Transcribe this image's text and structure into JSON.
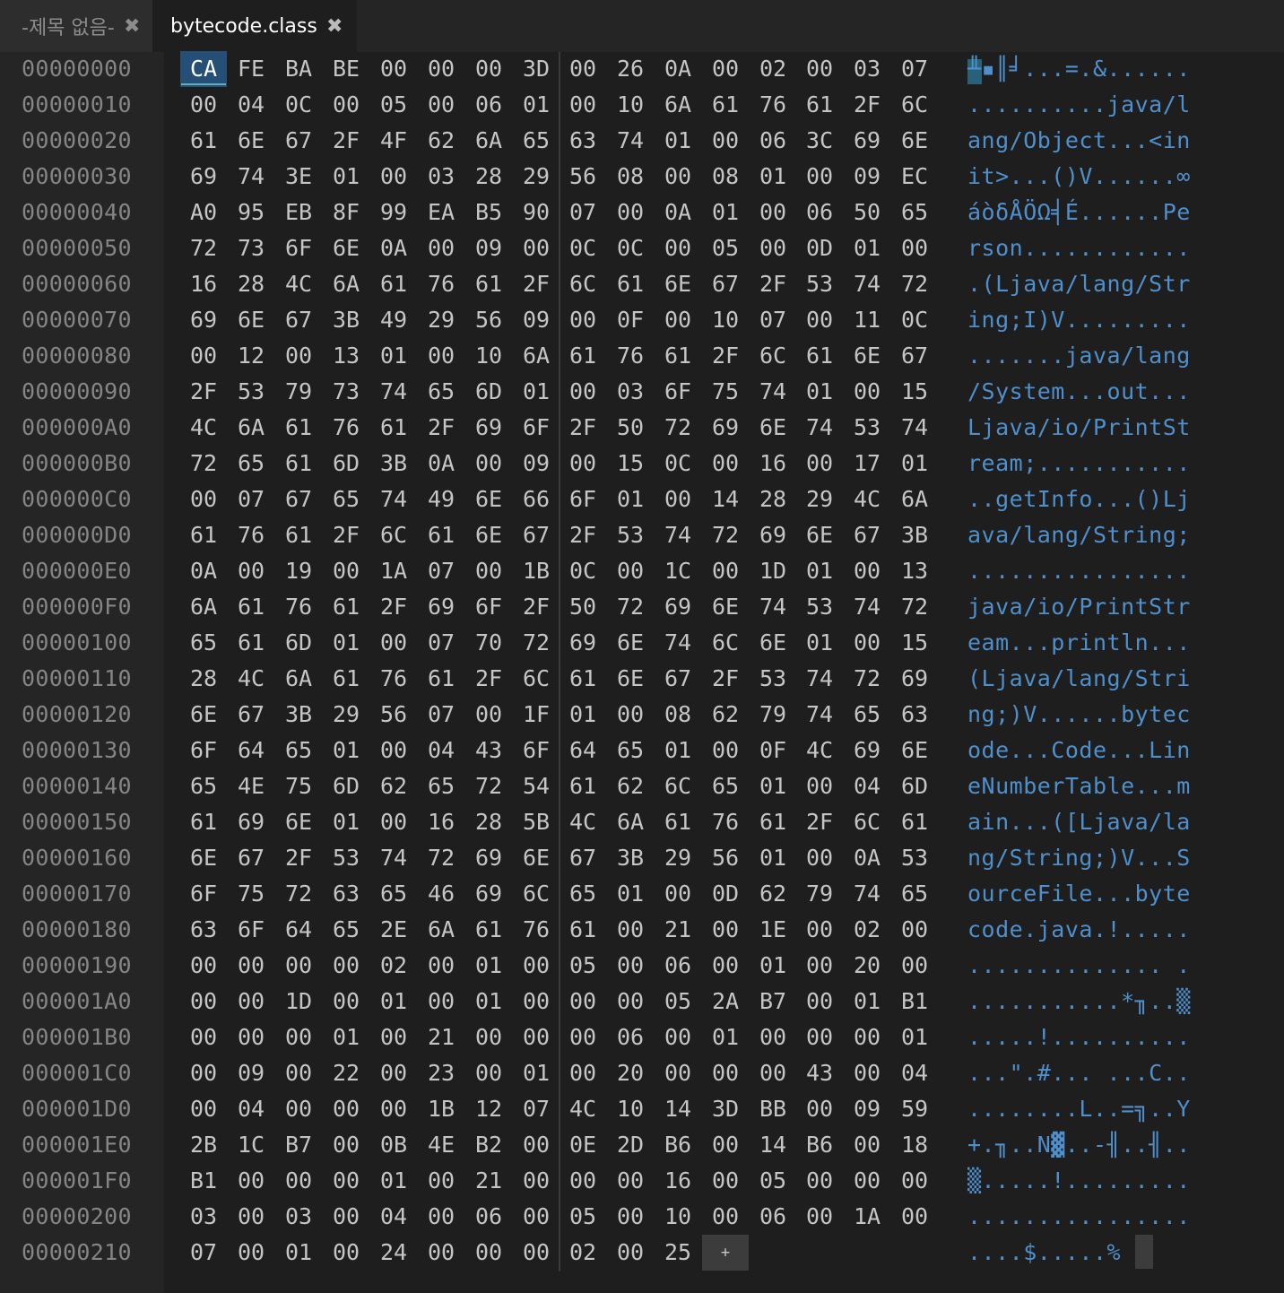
{
  "tabs": [
    {
      "label": "-제목 없음-",
      "active": false
    },
    {
      "label": "bytecode.class",
      "active": true
    }
  ],
  "close_glyph": "✖",
  "add_byte_label": "+",
  "selected": {
    "row": 0,
    "col": 0
  },
  "colors": {
    "accent": "#5eb1bb",
    "ascii_text": "#4f8fcc",
    "hex_text": "#c5c5c5",
    "offset_text": "#858585",
    "background": "#1e1e1e"
  },
  "rows": [
    {
      "offset": "00000000",
      "bytes": [
        "CA",
        "FE",
        "BA",
        "BE",
        "00",
        "00",
        "00",
        "3D",
        "00",
        "26",
        "0A",
        "00",
        "02",
        "00",
        "03",
        "07"
      ],
      "ascii": "╨▪║╛...=.&......"
    },
    {
      "offset": "00000010",
      "bytes": [
        "00",
        "04",
        "0C",
        "00",
        "05",
        "00",
        "06",
        "01",
        "00",
        "10",
        "6A",
        "61",
        "76",
        "61",
        "2F",
        "6C"
      ],
      "ascii": "..........java/l"
    },
    {
      "offset": "00000020",
      "bytes": [
        "61",
        "6E",
        "67",
        "2F",
        "4F",
        "62",
        "6A",
        "65",
        "63",
        "74",
        "01",
        "00",
        "06",
        "3C",
        "69",
        "6E"
      ],
      "ascii": "ang/Object...<in"
    },
    {
      "offset": "00000030",
      "bytes": [
        "69",
        "74",
        "3E",
        "01",
        "00",
        "03",
        "28",
        "29",
        "56",
        "08",
        "00",
        "08",
        "01",
        "00",
        "09",
        "EC"
      ],
      "ascii": "it>...()V......∞"
    },
    {
      "offset": "00000040",
      "bytes": [
        "A0",
        "95",
        "EB",
        "8F",
        "99",
        "EA",
        "B5",
        "90",
        "07",
        "00",
        "0A",
        "01",
        "00",
        "06",
        "50",
        "65"
      ],
      "ascii": "áòδÅÖΩ╡É......Pe"
    },
    {
      "offset": "00000050",
      "bytes": [
        "72",
        "73",
        "6F",
        "6E",
        "0A",
        "00",
        "09",
        "00",
        "0C",
        "0C",
        "00",
        "05",
        "00",
        "0D",
        "01",
        "00"
      ],
      "ascii": "rson............"
    },
    {
      "offset": "00000060",
      "bytes": [
        "16",
        "28",
        "4C",
        "6A",
        "61",
        "76",
        "61",
        "2F",
        "6C",
        "61",
        "6E",
        "67",
        "2F",
        "53",
        "74",
        "72"
      ],
      "ascii": ".(Ljava/lang/Str"
    },
    {
      "offset": "00000070",
      "bytes": [
        "69",
        "6E",
        "67",
        "3B",
        "49",
        "29",
        "56",
        "09",
        "00",
        "0F",
        "00",
        "10",
        "07",
        "00",
        "11",
        "0C"
      ],
      "ascii": "ing;I)V........."
    },
    {
      "offset": "00000080",
      "bytes": [
        "00",
        "12",
        "00",
        "13",
        "01",
        "00",
        "10",
        "6A",
        "61",
        "76",
        "61",
        "2F",
        "6C",
        "61",
        "6E",
        "67"
      ],
      "ascii": ".......java/lang"
    },
    {
      "offset": "00000090",
      "bytes": [
        "2F",
        "53",
        "79",
        "73",
        "74",
        "65",
        "6D",
        "01",
        "00",
        "03",
        "6F",
        "75",
        "74",
        "01",
        "00",
        "15"
      ],
      "ascii": "/System...out..."
    },
    {
      "offset": "000000A0",
      "bytes": [
        "4C",
        "6A",
        "61",
        "76",
        "61",
        "2F",
        "69",
        "6F",
        "2F",
        "50",
        "72",
        "69",
        "6E",
        "74",
        "53",
        "74"
      ],
      "ascii": "Ljava/io/PrintSt"
    },
    {
      "offset": "000000B0",
      "bytes": [
        "72",
        "65",
        "61",
        "6D",
        "3B",
        "0A",
        "00",
        "09",
        "00",
        "15",
        "0C",
        "00",
        "16",
        "00",
        "17",
        "01"
      ],
      "ascii": "ream;..........."
    },
    {
      "offset": "000000C0",
      "bytes": [
        "00",
        "07",
        "67",
        "65",
        "74",
        "49",
        "6E",
        "66",
        "6F",
        "01",
        "00",
        "14",
        "28",
        "29",
        "4C",
        "6A"
      ],
      "ascii": "..getInfo...()Lj"
    },
    {
      "offset": "000000D0",
      "bytes": [
        "61",
        "76",
        "61",
        "2F",
        "6C",
        "61",
        "6E",
        "67",
        "2F",
        "53",
        "74",
        "72",
        "69",
        "6E",
        "67",
        "3B"
      ],
      "ascii": "ava/lang/String;"
    },
    {
      "offset": "000000E0",
      "bytes": [
        "0A",
        "00",
        "19",
        "00",
        "1A",
        "07",
        "00",
        "1B",
        "0C",
        "00",
        "1C",
        "00",
        "1D",
        "01",
        "00",
        "13"
      ],
      "ascii": "................"
    },
    {
      "offset": "000000F0",
      "bytes": [
        "6A",
        "61",
        "76",
        "61",
        "2F",
        "69",
        "6F",
        "2F",
        "50",
        "72",
        "69",
        "6E",
        "74",
        "53",
        "74",
        "72"
      ],
      "ascii": "java/io/PrintStr"
    },
    {
      "offset": "00000100",
      "bytes": [
        "65",
        "61",
        "6D",
        "01",
        "00",
        "07",
        "70",
        "72",
        "69",
        "6E",
        "74",
        "6C",
        "6E",
        "01",
        "00",
        "15"
      ],
      "ascii": "eam...println..."
    },
    {
      "offset": "00000110",
      "bytes": [
        "28",
        "4C",
        "6A",
        "61",
        "76",
        "61",
        "2F",
        "6C",
        "61",
        "6E",
        "67",
        "2F",
        "53",
        "74",
        "72",
        "69"
      ],
      "ascii": "(Ljava/lang/Stri"
    },
    {
      "offset": "00000120",
      "bytes": [
        "6E",
        "67",
        "3B",
        "29",
        "56",
        "07",
        "00",
        "1F",
        "01",
        "00",
        "08",
        "62",
        "79",
        "74",
        "65",
        "63"
      ],
      "ascii": "ng;)V......bytec"
    },
    {
      "offset": "00000130",
      "bytes": [
        "6F",
        "64",
        "65",
        "01",
        "00",
        "04",
        "43",
        "6F",
        "64",
        "65",
        "01",
        "00",
        "0F",
        "4C",
        "69",
        "6E"
      ],
      "ascii": "ode...Code...Lin"
    },
    {
      "offset": "00000140",
      "bytes": [
        "65",
        "4E",
        "75",
        "6D",
        "62",
        "65",
        "72",
        "54",
        "61",
        "62",
        "6C",
        "65",
        "01",
        "00",
        "04",
        "6D"
      ],
      "ascii": "eNumberTable...m"
    },
    {
      "offset": "00000150",
      "bytes": [
        "61",
        "69",
        "6E",
        "01",
        "00",
        "16",
        "28",
        "5B",
        "4C",
        "6A",
        "61",
        "76",
        "61",
        "2F",
        "6C",
        "61"
      ],
      "ascii": "ain...([Ljava/la"
    },
    {
      "offset": "00000160",
      "bytes": [
        "6E",
        "67",
        "2F",
        "53",
        "74",
        "72",
        "69",
        "6E",
        "67",
        "3B",
        "29",
        "56",
        "01",
        "00",
        "0A",
        "53"
      ],
      "ascii": "ng/String;)V...S"
    },
    {
      "offset": "00000170",
      "bytes": [
        "6F",
        "75",
        "72",
        "63",
        "65",
        "46",
        "69",
        "6C",
        "65",
        "01",
        "00",
        "0D",
        "62",
        "79",
        "74",
        "65"
      ],
      "ascii": "ourceFile...byte"
    },
    {
      "offset": "00000180",
      "bytes": [
        "63",
        "6F",
        "64",
        "65",
        "2E",
        "6A",
        "61",
        "76",
        "61",
        "00",
        "21",
        "00",
        "1E",
        "00",
        "02",
        "00"
      ],
      "ascii": "code.java.!....."
    },
    {
      "offset": "00000190",
      "bytes": [
        "00",
        "00",
        "00",
        "00",
        "02",
        "00",
        "01",
        "00",
        "05",
        "00",
        "06",
        "00",
        "01",
        "00",
        "20",
        "00"
      ],
      "ascii": ".............. ."
    },
    {
      "offset": "000001A0",
      "bytes": [
        "00",
        "00",
        "1D",
        "00",
        "01",
        "00",
        "01",
        "00",
        "00",
        "00",
        "05",
        "2A",
        "B7",
        "00",
        "01",
        "B1"
      ],
      "ascii": "...........*╖..▒"
    },
    {
      "offset": "000001B0",
      "bytes": [
        "00",
        "00",
        "00",
        "01",
        "00",
        "21",
        "00",
        "00",
        "00",
        "06",
        "00",
        "01",
        "00",
        "00",
        "00",
        "01"
      ],
      "ascii": ".....!.........."
    },
    {
      "offset": "000001C0",
      "bytes": [
        "00",
        "09",
        "00",
        "22",
        "00",
        "23",
        "00",
        "01",
        "00",
        "20",
        "00",
        "00",
        "00",
        "43",
        "00",
        "04"
      ],
      "ascii": "...\".#... ...C.."
    },
    {
      "offset": "000001D0",
      "bytes": [
        "00",
        "04",
        "00",
        "00",
        "00",
        "1B",
        "12",
        "07",
        "4C",
        "10",
        "14",
        "3D",
        "BB",
        "00",
        "09",
        "59"
      ],
      "ascii": "........L..=╗..Y"
    },
    {
      "offset": "000001E0",
      "bytes": [
        "2B",
        "1C",
        "B7",
        "00",
        "0B",
        "4E",
        "B2",
        "00",
        "0E",
        "2D",
        "B6",
        "00",
        "14",
        "B6",
        "00",
        "18"
      ],
      "ascii": "+.╖..N▓..-╢..╢.."
    },
    {
      "offset": "000001F0",
      "bytes": [
        "B1",
        "00",
        "00",
        "00",
        "01",
        "00",
        "21",
        "00",
        "00",
        "00",
        "16",
        "00",
        "05",
        "00",
        "00",
        "00"
      ],
      "ascii": "▒.....!........."
    },
    {
      "offset": "00000200",
      "bytes": [
        "03",
        "00",
        "03",
        "00",
        "04",
        "00",
        "06",
        "00",
        "05",
        "00",
        "10",
        "00",
        "06",
        "00",
        "1A",
        "00"
      ],
      "ascii": "................"
    },
    {
      "offset": "00000210",
      "bytes": [
        "07",
        "00",
        "01",
        "00",
        "24",
        "00",
        "00",
        "00",
        "02",
        "00",
        "25"
      ],
      "ascii": "....$.....%"
    }
  ]
}
